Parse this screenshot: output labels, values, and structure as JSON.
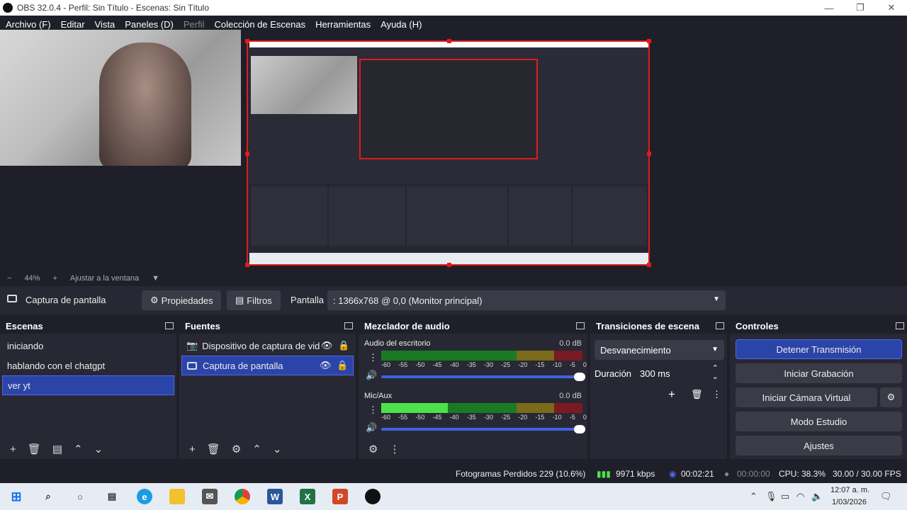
{
  "window": {
    "title": "OBS 32.0.4 - Perfil: Sin Título - Escenas: Sin Título"
  },
  "menu": [
    "Archivo (F)",
    "Editar",
    "Vista",
    "Paneles (D)",
    "Perfil",
    "Colección de Escenas",
    "Herramientas",
    "Ayuda (H)"
  ],
  "zoom": {
    "minus": "−",
    "value": "44%",
    "plus": "+",
    "fit": "Ajustar a la ventana",
    "menu": "▼"
  },
  "source_bar": {
    "source_name": "Captura de pantalla",
    "properties": "Propiedades",
    "filters": "Filtros",
    "display_label": "Pantalla",
    "display_value": ": 1366x768 @ 0,0 (Monitor principal)"
  },
  "scenes": {
    "title": "Escenas",
    "items": [
      "iniciando",
      "hablando con el chatgpt",
      "ver yt"
    ],
    "selected": "ver yt"
  },
  "sources": {
    "title": "Fuentes",
    "items": [
      "Dispositivo de captura de vid",
      "Captura de pantalla"
    ]
  },
  "mixer": {
    "title": "Mezclador de audio",
    "channels": [
      {
        "name": "Audio del escritorio",
        "db": "0.0 dB",
        "level": 0
      },
      {
        "name": "Mic/Aux",
        "db": "0.0 dB",
        "level": 0.33
      }
    ],
    "ticks": [
      "-60",
      "-55",
      "-50",
      "-45",
      "-40",
      "-35",
      "-30",
      "-25",
      "-20",
      "-15",
      "-10",
      "-5",
      "0"
    ]
  },
  "transitions": {
    "title": "Transiciones de escena",
    "type": "Desvanecimiento",
    "duration_label": "Duración",
    "duration_value": "300 ms"
  },
  "controls": {
    "title": "Controles",
    "stop_stream": "Detener Transmisión",
    "start_record": "Iniciar Grabación",
    "virtual_cam": "Iniciar Cámara Virtual",
    "studio": "Modo Estudio",
    "settings": "Ajustes"
  },
  "status": {
    "dropped": "Fotogramas Perdidos 229 (10.6%)",
    "bitrate": "9971 kbps",
    "stream_time": "00:02:21",
    "record_time": "00:00:00",
    "cpu": "CPU: 38.3%",
    "fps": "30.00 / 30.00 FPS"
  },
  "taskbar": {
    "time": "12:07 a. m.",
    "date": "1/03/2026"
  },
  "colors": {
    "accent": "#2b44a8",
    "selection_border": "#e01b1b",
    "meter_green": "#4de24a"
  }
}
